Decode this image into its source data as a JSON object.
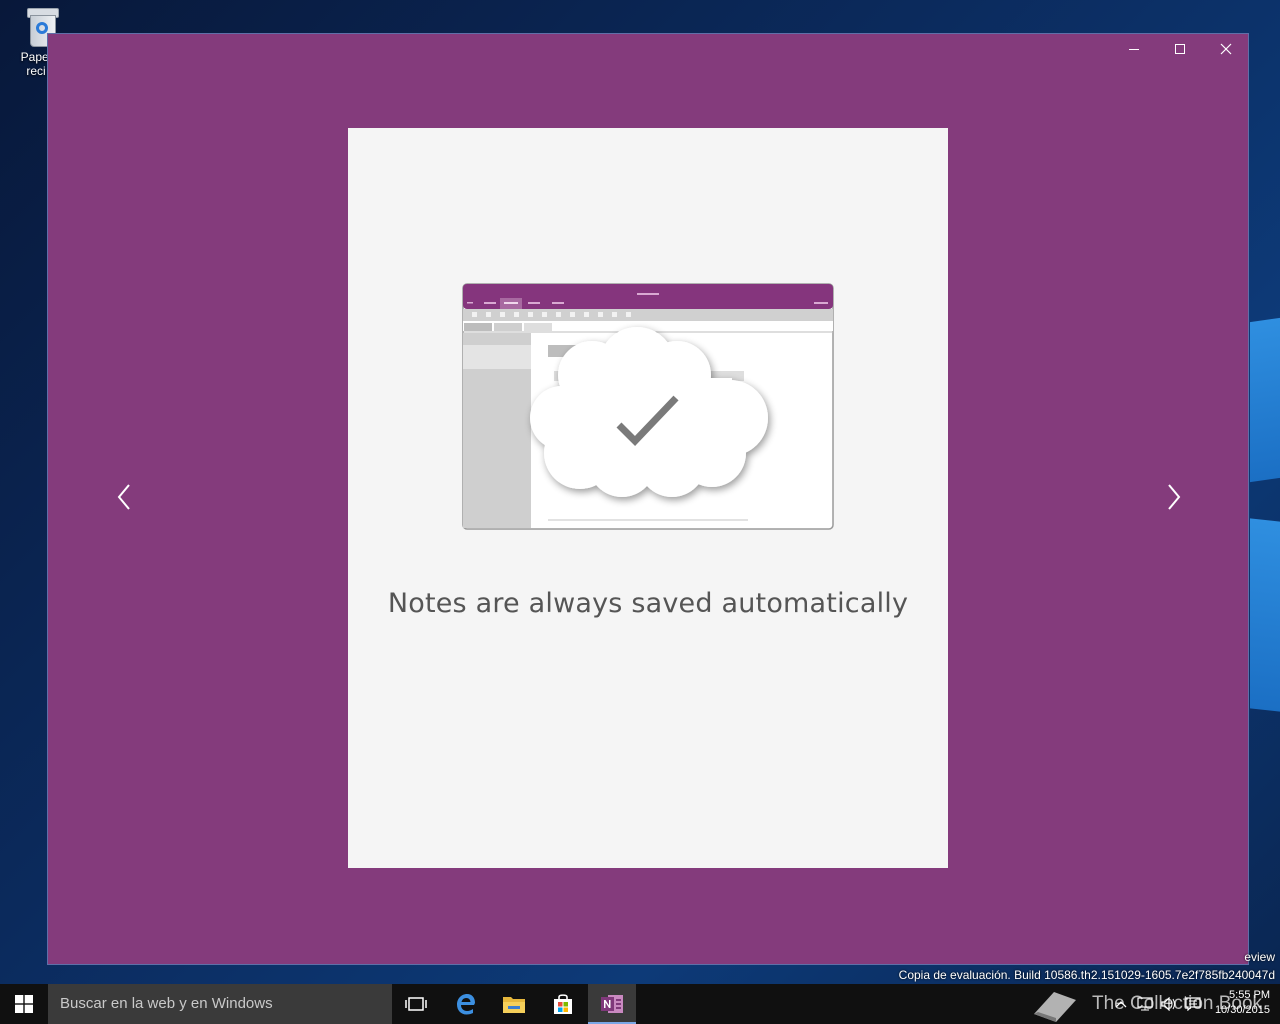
{
  "desktop": {
    "recycle_bin_label": "Papel… reci…"
  },
  "window": {
    "minimize_icon": "minimize-icon",
    "maximize_icon": "maximize-icon",
    "close_icon": "close-icon",
    "background_color": "#843b7c"
  },
  "slide": {
    "caption": "Notes are always saved automatically",
    "prev_icon": "chevron-left-icon",
    "next_icon": "chevron-right-icon"
  },
  "watermark": {
    "line1": "eview",
    "line2": "Copia de evaluación. Build 10586.th2.151029-1605.7e2f785fb240047d"
  },
  "taskbar": {
    "search_placeholder": "Buscar en la web y en Windows",
    "time": "5:55 PM",
    "date": "10/30/2015",
    "brand_text": "The Collection Book"
  }
}
